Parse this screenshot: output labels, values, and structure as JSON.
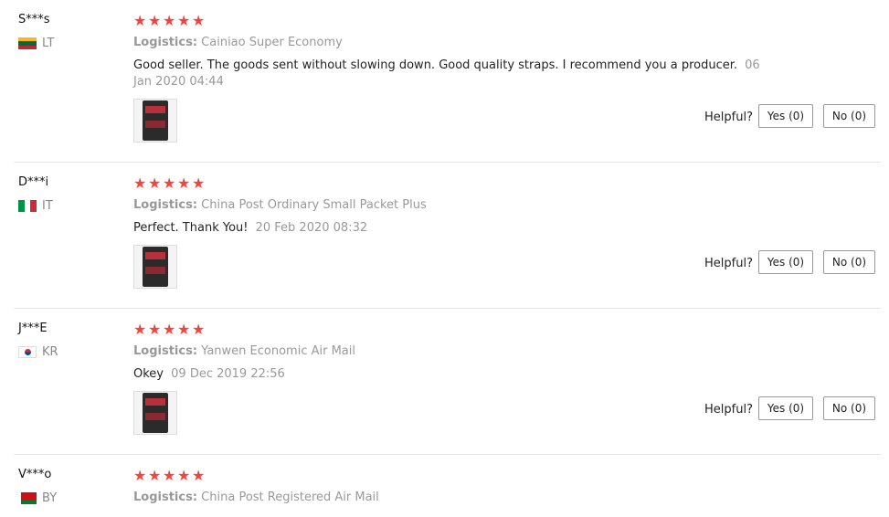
{
  "labels": {
    "logistics": "Logistics:",
    "helpful": "Helpful?"
  },
  "star_color": "#f4453c",
  "reviews": [
    {
      "user": "S***s",
      "country": "LT",
      "flag": [
        "#fdb913",
        "#006a44",
        "#c1272d"
      ],
      "rating": 5,
      "logistics": "Cainiao Super Economy",
      "text": "Good seller. The goods sent without slowing down. Good quality straps. I recommend you a producer.",
      "date": "06 Jan 2020 04:44",
      "yes": "Yes (0)",
      "no": "No (0)"
    },
    {
      "user": "D***i",
      "country": "IT",
      "flag": [
        "#009246",
        "#ffffff",
        "#ce2b37"
      ],
      "rating": 5,
      "logistics": "China Post Ordinary Small Packet Plus",
      "text": "Perfect. Thank You!",
      "date": "20 Feb 2020 08:32",
      "yes": "Yes (0)",
      "no": "No (0)"
    },
    {
      "user": "J***E",
      "country": "KR",
      "flag": [
        "#ffffff",
        "#cd2e3a",
        "#0047a0"
      ],
      "rating": 5,
      "logistics": "Yanwen Economic Air Mail",
      "text": "Okey",
      "date": "09 Dec 2019 22:56",
      "yes": "Yes (0)",
      "no": "No (0)"
    },
    {
      "user": "V***o",
      "country": "BY",
      "flag": [
        "#cf101a",
        "#cf101a",
        "#007d2c"
      ],
      "rating": 5,
      "logistics": "China Post Registered Air Mail"
    }
  ]
}
